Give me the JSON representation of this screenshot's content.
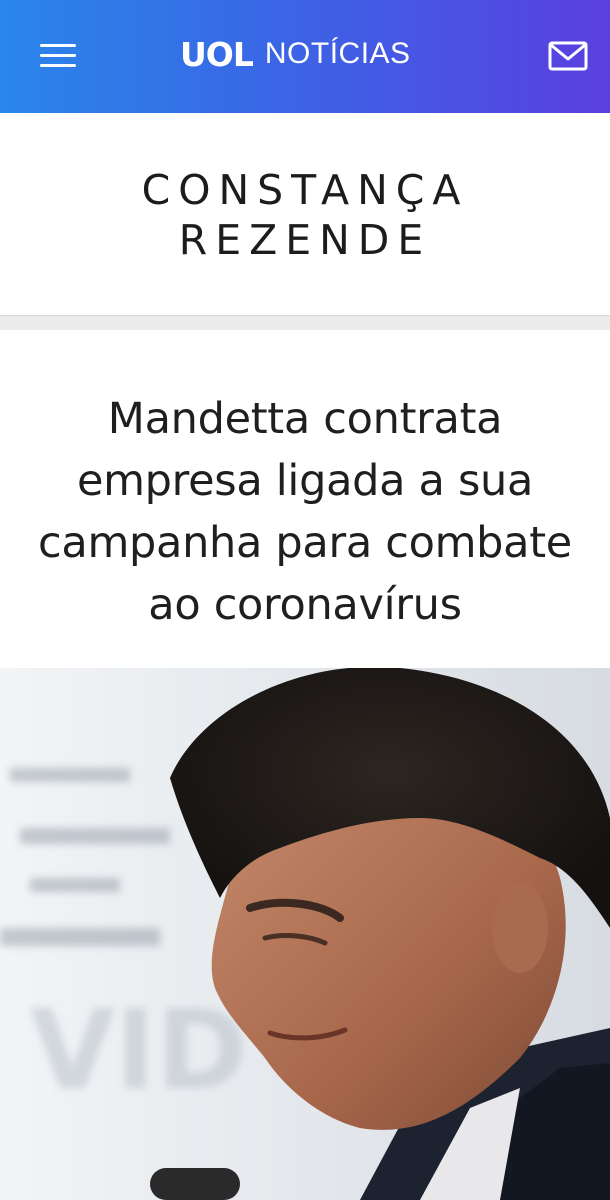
{
  "header": {
    "logo": "UOL",
    "section": "NOTÍCIAS",
    "menu_icon": "hamburger-menu-icon",
    "mail_icon": "mail-icon",
    "gradient_start": "#2a86ea",
    "gradient_end": "#5a3fe0"
  },
  "author": {
    "name": "CONSTANÇA REZENDE"
  },
  "article": {
    "headline": "Mandetta contrata empresa ligada a sua campanha para combate ao coronavírus",
    "image_background_text": "VID"
  }
}
